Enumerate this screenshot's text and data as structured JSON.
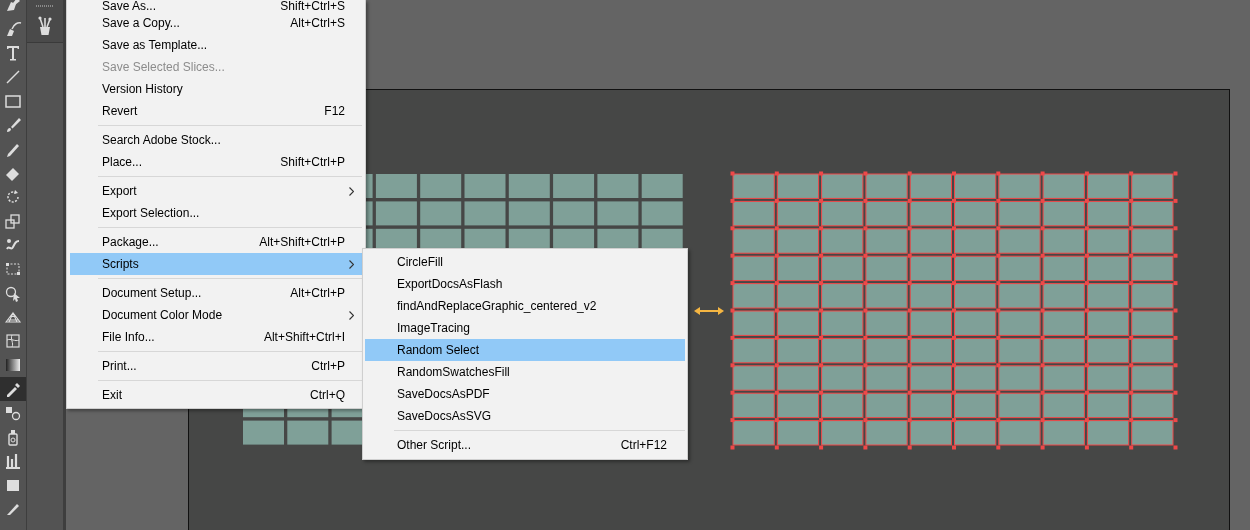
{
  "toolbar": {
    "tools": [
      {
        "kind": "pen",
        "selected": false
      },
      {
        "kind": "curvature",
        "selected": false
      },
      {
        "kind": "type",
        "selected": false
      },
      {
        "kind": "line",
        "selected": false
      },
      {
        "kind": "rectangle",
        "selected": false
      },
      {
        "kind": "paintbrush",
        "selected": false
      },
      {
        "kind": "shaper",
        "selected": false
      },
      {
        "kind": "eraser",
        "selected": false
      },
      {
        "kind": "rotate",
        "selected": false
      },
      {
        "kind": "scale",
        "selected": false
      },
      {
        "kind": "warp",
        "selected": false
      },
      {
        "kind": "free-transform",
        "selected": false
      },
      {
        "kind": "shape-builder",
        "selected": false
      },
      {
        "kind": "perspective-grid",
        "selected": false
      },
      {
        "kind": "mesh",
        "selected": false
      },
      {
        "kind": "gradient",
        "selected": false
      },
      {
        "kind": "eyedropper",
        "selected": true
      },
      {
        "kind": "blend",
        "selected": false
      },
      {
        "kind": "symbol-sprayer",
        "selected": false
      },
      {
        "kind": "column-graph",
        "selected": false
      },
      {
        "kind": "artboard",
        "selected": false
      },
      {
        "kind": "slice",
        "selected": false
      }
    ]
  },
  "file_menu": {
    "items": [
      {
        "kind": "item",
        "label": "Save As...",
        "shortcut": "Shift+Ctrl+S",
        "disabled": false,
        "selected": false,
        "submenu": false
      },
      {
        "kind": "item",
        "label": "Save a Copy...",
        "shortcut": "Alt+Ctrl+S",
        "disabled": false,
        "selected": false,
        "submenu": false
      },
      {
        "kind": "item",
        "label": "Save as Template...",
        "disabled": false,
        "selected": false,
        "submenu": false
      },
      {
        "kind": "item",
        "label": "Save Selected Slices...",
        "disabled": true,
        "selected": false,
        "submenu": false
      },
      {
        "kind": "item",
        "label": "Version History",
        "disabled": false,
        "selected": false,
        "submenu": false
      },
      {
        "kind": "item",
        "label": "Revert",
        "shortcut": "F12",
        "disabled": false,
        "selected": false,
        "submenu": false
      },
      {
        "kind": "separator"
      },
      {
        "kind": "item",
        "label": "Search Adobe Stock...",
        "disabled": false,
        "selected": false,
        "submenu": false
      },
      {
        "kind": "item",
        "label": "Place...",
        "shortcut": "Shift+Ctrl+P",
        "disabled": false,
        "selected": false,
        "submenu": false
      },
      {
        "kind": "separator"
      },
      {
        "kind": "item",
        "label": "Export",
        "disabled": false,
        "selected": false,
        "submenu": true
      },
      {
        "kind": "item",
        "label": "Export Selection...",
        "disabled": false,
        "selected": false,
        "submenu": false
      },
      {
        "kind": "separator"
      },
      {
        "kind": "item",
        "label": "Package...",
        "shortcut": "Alt+Shift+Ctrl+P",
        "disabled": false,
        "selected": false,
        "submenu": false
      },
      {
        "kind": "item",
        "label": "Scripts",
        "disabled": false,
        "selected": true,
        "submenu": true
      },
      {
        "kind": "separator"
      },
      {
        "kind": "item",
        "label": "Document Setup...",
        "shortcut": "Alt+Ctrl+P",
        "disabled": false,
        "selected": false,
        "submenu": false
      },
      {
        "kind": "item",
        "label": "Document Color Mode",
        "disabled": false,
        "selected": false,
        "submenu": true
      },
      {
        "kind": "item",
        "label": "File Info...",
        "shortcut": "Alt+Shift+Ctrl+I",
        "disabled": false,
        "selected": false,
        "submenu": false
      },
      {
        "kind": "separator"
      },
      {
        "kind": "item",
        "label": "Print...",
        "shortcut": "Ctrl+P",
        "disabled": false,
        "selected": false,
        "submenu": false
      },
      {
        "kind": "separator"
      },
      {
        "kind": "item",
        "label": "Exit",
        "shortcut": "Ctrl+Q",
        "disabled": false,
        "selected": false,
        "submenu": false
      }
    ]
  },
  "scripts_submenu": {
    "items": [
      {
        "kind": "item",
        "label": "CircleFill",
        "selected": false
      },
      {
        "kind": "item",
        "label": "ExportDocsAsFlash",
        "selected": false
      },
      {
        "kind": "item",
        "label": "findAndReplaceGraphic_centered_v2",
        "selected": false
      },
      {
        "kind": "item",
        "label": "ImageTracing",
        "selected": false
      },
      {
        "kind": "item",
        "label": "Random Select",
        "selected": true
      },
      {
        "kind": "item",
        "label": "RandomSwatchesFill",
        "selected": false
      },
      {
        "kind": "item",
        "label": "SaveDocsAsPDF",
        "selected": false
      },
      {
        "kind": "item",
        "label": "SaveDocsAsSVG",
        "selected": false
      },
      {
        "kind": "separator"
      },
      {
        "kind": "item",
        "label": "Other Script...",
        "shortcut": "Ctrl+F12",
        "selected": false
      }
    ]
  }
}
